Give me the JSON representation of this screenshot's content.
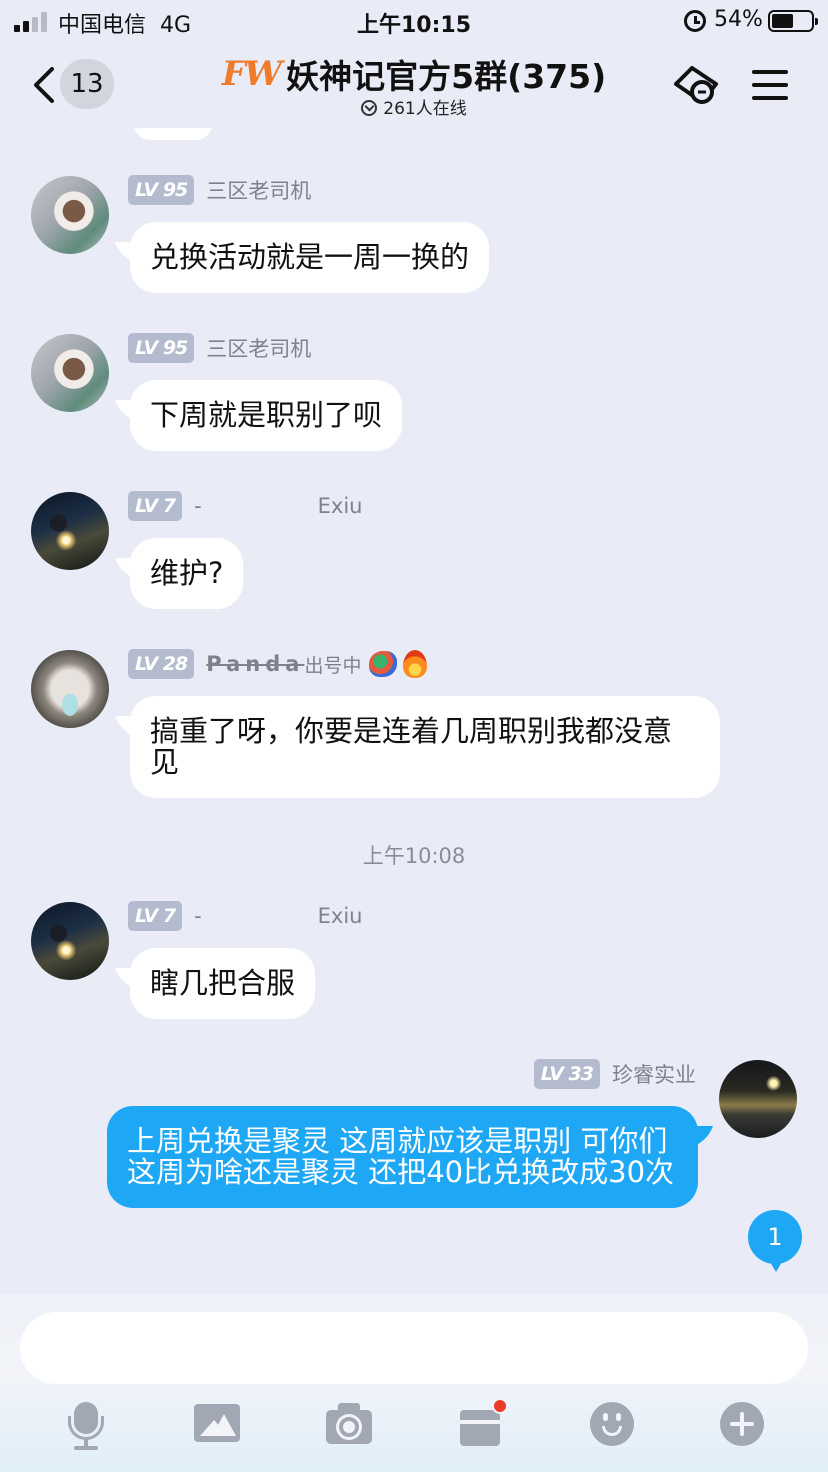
{
  "status_bar": {
    "carrier": "中国电信",
    "network": "4G",
    "time": "上午10:15",
    "battery_percent": "54%",
    "battery_level": 0.54,
    "signal_bars": 2
  },
  "header": {
    "unread_count": "13",
    "logo": "FW",
    "title": "妖神记官方5群(375)",
    "online": "261人在线"
  },
  "messages": [
    {
      "level": "95",
      "nickname": "三区老司机",
      "text": "兑换活动就是一周一换的",
      "avatar": "cat-avatar"
    },
    {
      "level": "95",
      "nickname": "三区老司机",
      "text": "下周就是职别了呗",
      "avatar": "cat-avatar"
    },
    {
      "level": "7",
      "nickname": "-",
      "nickname_extra": "Exiu",
      "text": "维护?",
      "avatar": "night-avatar"
    },
    {
      "level": "28",
      "nickname": "Panda",
      "nickname_suffix": "出号中",
      "text": "搞重了呀，你要是连着几周职别我都没意见",
      "avatar": "mask-avatar",
      "badges": [
        "dragon-badge",
        "fire-badge"
      ]
    },
    {
      "level": "7",
      "nickname": "-",
      "nickname_extra": "Exiu",
      "text": "瞎几把合服",
      "avatar": "night-avatar"
    }
  ],
  "timestamp": "上午10:08",
  "my_message": {
    "level": "33",
    "nickname": "珍睿实业",
    "text": "上周兑换是聚灵  这周就应该是职别  可你们这周为啥还是聚灵  还把40比兑换改成30次"
  },
  "unread_new": "1",
  "lv_prefix": "LV",
  "input": {
    "placeholder": "",
    "value": ""
  },
  "colors": {
    "background": "#e9ecf7",
    "my_bubble": "#1ea7f5",
    "level_badge": "#b4bbcf",
    "logo": "#f07b2b",
    "gift_dot": "#ec3b2a"
  },
  "toolbar": [
    "mic-icon",
    "image-icon",
    "camera-icon",
    "gift-icon",
    "emoji-icon",
    "plus-icon"
  ]
}
